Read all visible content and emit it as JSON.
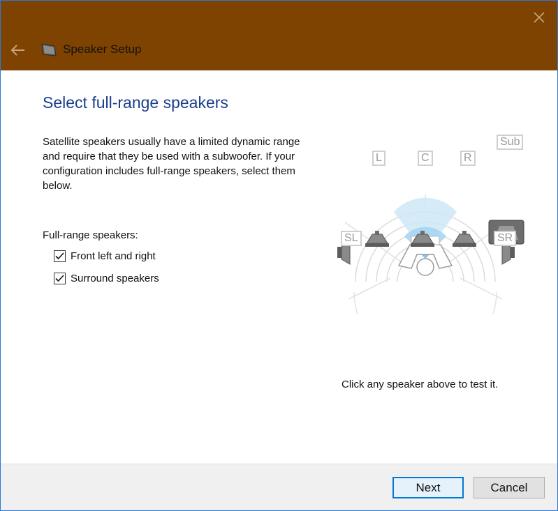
{
  "window": {
    "title": "Speaker Setup",
    "titlebar_color": "#7e4300",
    "border_color": "#2b79d6"
  },
  "icons": {
    "back": "back-arrow-icon",
    "close": "close-icon",
    "app": "speaker-setup-icon"
  },
  "page": {
    "heading": "Select full-range speakers",
    "heading_color": "#1a3e8c",
    "description": "Satellite speakers usually have a limited dynamic range and require that they be used with a subwoofer. If your configuration includes full-range speakers, select them below.",
    "group_label": "Full-range speakers:",
    "options": [
      {
        "label": "Front left and right",
        "checked": true
      },
      {
        "label": "Surround speakers",
        "checked": true
      }
    ]
  },
  "diagram": {
    "speakers": {
      "left": "L",
      "center": "C",
      "right": "R",
      "subwoofer": "Sub",
      "surround_left": "SL",
      "surround_right": "SR"
    },
    "hint": "Click any speaker above to test it."
  },
  "footer": {
    "next_label": "Next",
    "cancel_label": "Cancel"
  }
}
